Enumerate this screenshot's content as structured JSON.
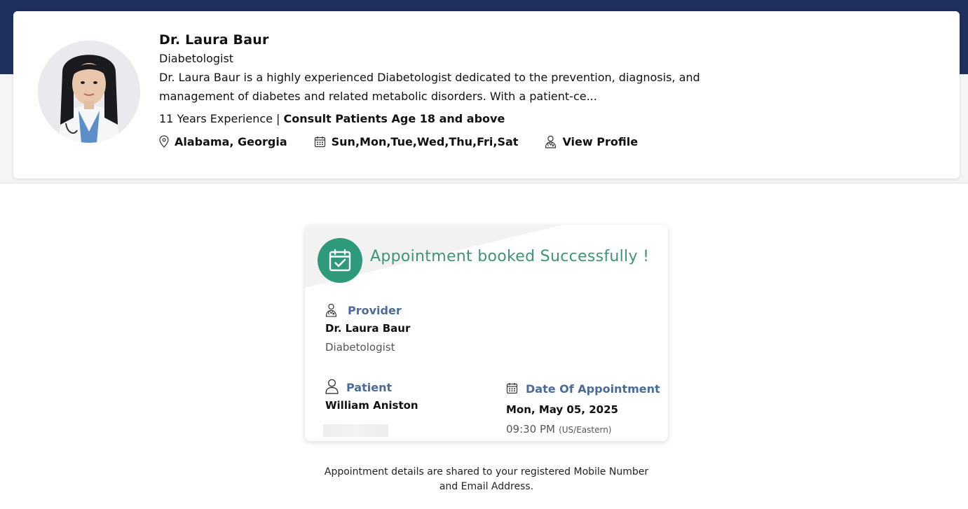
{
  "doctor": {
    "name": "Dr. Laura Baur",
    "specialty": "Diabetologist",
    "bio": "Dr. Laura Baur is a highly experienced Diabetologist dedicated to the prevention, diagnosis, and management of diabetes and related metabolic disorders. With a patient-ce...",
    "experience": "11 Years Experience |",
    "consult_age": "Consult Patients Age 18 and above",
    "location": "Alabama, Georgia",
    "days": "Sun,Mon,Tue,Wed,Thu,Fri,Sat",
    "view_profile": "View Profile"
  },
  "confirmation": {
    "title": "Appointment booked Successfully !",
    "provider_label": "Provider",
    "provider_name": "Dr. Laura Baur",
    "provider_specialty": "Diabetologist",
    "patient_label": "Patient",
    "patient_name": "William Aniston",
    "date_label": "Date Of Appointment",
    "date_value": "Mon, May 05, 2025",
    "time_value": "09:30 PM",
    "timezone": "(US/Eastern)"
  },
  "footer": {
    "note_line1": "Appointment details are shared to your registered Mobile Number",
    "note_line2": "and Email Address."
  },
  "colors": {
    "header_navy": "#1f305e",
    "success_green": "#2f9a7b",
    "title_green": "#3e9474",
    "label_blue": "#4b6b9b"
  },
  "icons": [
    "location-pin-icon",
    "calendar-icon",
    "doctor-icon",
    "calendar-check-icon",
    "user-icon"
  ]
}
